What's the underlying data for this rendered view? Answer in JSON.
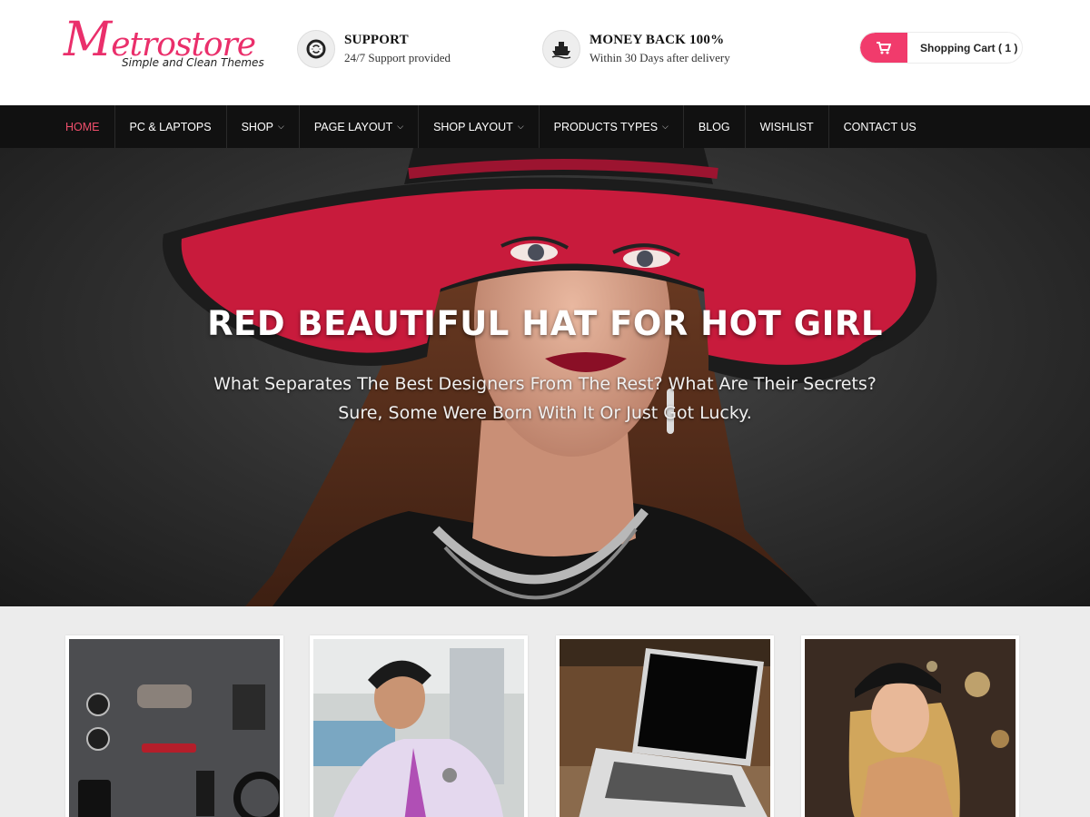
{
  "header": {
    "logo": {
      "title_initial": "M",
      "title_rest": "etrostore",
      "tagline": "Simple and Clean Themes"
    },
    "features": [
      {
        "icon": "lifebuoy-icon",
        "title": "SUPPORT",
        "subtitle": "24/7 Support provided"
      },
      {
        "icon": "ship-icon",
        "title": "MONEY BACK 100%",
        "subtitle": "Within 30 Days after delivery"
      }
    ],
    "cart": {
      "icon": "cart-icon",
      "label": "Shopping Cart ( 1 )"
    }
  },
  "nav": {
    "items": [
      {
        "label": "HOME",
        "active": true,
        "dropdown": false
      },
      {
        "label": "PC & LAPTOPS",
        "dropdown": false
      },
      {
        "label": "SHOP",
        "dropdown": true
      },
      {
        "label": "PAGE LAYOUT",
        "dropdown": true
      },
      {
        "label": "SHOP LAYOUT",
        "dropdown": true
      },
      {
        "label": "PRODUCTS TYPES",
        "dropdown": true
      },
      {
        "label": "BLOG",
        "dropdown": false
      },
      {
        "label": "WISHLIST",
        "dropdown": false
      },
      {
        "label": "CONTACT US",
        "dropdown": false
      }
    ],
    "dropdown_caret": "⌄"
  },
  "hero": {
    "title": "RED BEAUTIFUL HAT FOR HOT GIRL",
    "subtitle": "What Separates The Best Designers From The Rest? What Are Their Secrets? Sure, Some Were Born With It Or Just Got Lucky."
  },
  "colors": {
    "accent": "#f13b6c",
    "nav_bg": "#111111",
    "nav_active": "#f04f6c",
    "logo": "#ea2f6b"
  }
}
